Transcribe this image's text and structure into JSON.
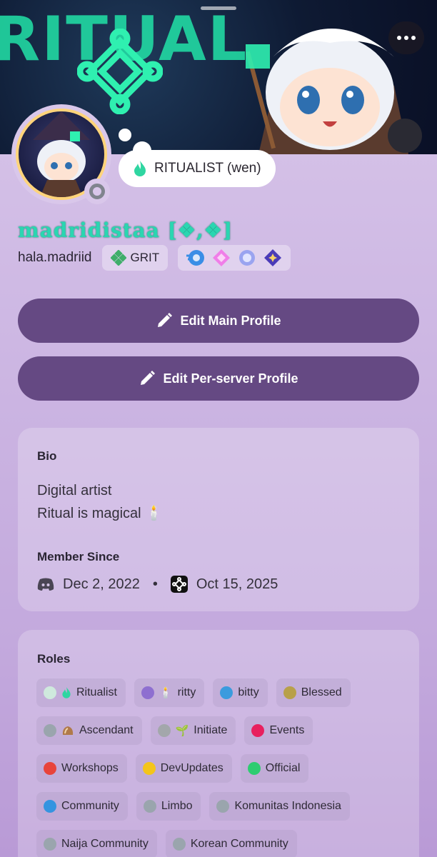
{
  "banner": {
    "text": "RITUAL"
  },
  "status": {
    "emoji": "green-flame-icon",
    "text": "RITUALIST (wen)"
  },
  "profile": {
    "display_name": "madridistaa [❖,❖]",
    "username": "hala.madriid",
    "guild_tag": "GRIT",
    "badges": [
      "nitro-icon",
      "boost-gem-icon",
      "quest-icon",
      "orbs-icon"
    ]
  },
  "buttons": {
    "edit_main": "Edit Main Profile",
    "edit_server": "Edit Per-server Profile"
  },
  "bio": {
    "title": "Bio",
    "line1": "Digital artist",
    "line2": "Ritual is magical 🕯️"
  },
  "member_since": {
    "title": "Member Since",
    "discord_date": "Dec 2, 2022",
    "server_date": "Oct 15, 2025",
    "separator": "•"
  },
  "roles": {
    "title": "Roles",
    "items": [
      {
        "name": "Ritualist",
        "emoji": "",
        "color": "#cfe9dd"
      },
      {
        "name": "ritty",
        "emoji": "🕯️",
        "color": "#8e6fd0"
      },
      {
        "name": "bitty",
        "emoji": "",
        "color": "#3b9bde"
      },
      {
        "name": "Blessed",
        "emoji": "",
        "color": "#b8a04a"
      },
      {
        "name": "Ascendant",
        "emoji": "",
        "color": "#9aa5ad"
      },
      {
        "name": "Initiate",
        "emoji": "🌱",
        "color": "#a3a7ab"
      },
      {
        "name": "Events",
        "emoji": "",
        "color": "#e8205e"
      },
      {
        "name": "Workshops",
        "emoji": "",
        "color": "#e8443a"
      },
      {
        "name": "DevUpdates",
        "emoji": "",
        "color": "#f4c51a"
      },
      {
        "name": "Official",
        "emoji": "",
        "color": "#2ecc71"
      },
      {
        "name": "Community",
        "emoji": "",
        "color": "#3594e0"
      },
      {
        "name": "Limbo",
        "emoji": "",
        "color": "#9aa5ad"
      },
      {
        "name": "Komunitas Indonesia",
        "emoji": "",
        "color": "#9aa5ad"
      },
      {
        "name": "Naija Community",
        "emoji": "",
        "color": "#9aa5ad"
      },
      {
        "name": "Korean Community",
        "emoji": "",
        "color": "#9aa5ad"
      }
    ]
  }
}
